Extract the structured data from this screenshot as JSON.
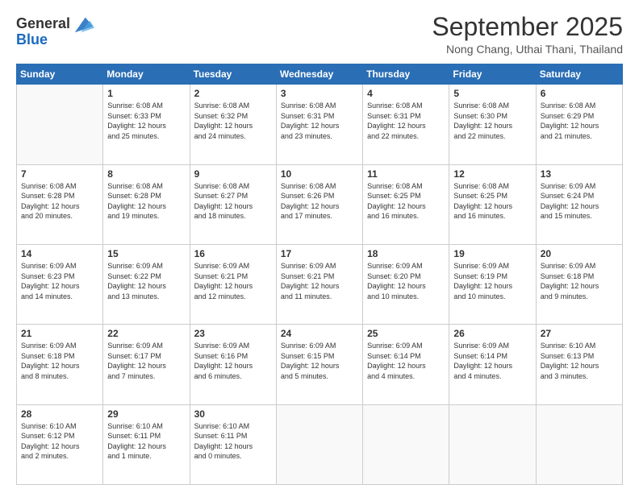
{
  "header": {
    "logo_general": "General",
    "logo_blue": "Blue",
    "month_title": "September 2025",
    "location": "Nong Chang, Uthai Thani, Thailand"
  },
  "days_of_week": [
    "Sunday",
    "Monday",
    "Tuesday",
    "Wednesday",
    "Thursday",
    "Friday",
    "Saturday"
  ],
  "weeks": [
    [
      {
        "day": "",
        "info": ""
      },
      {
        "day": "1",
        "info": "Sunrise: 6:08 AM\nSunset: 6:33 PM\nDaylight: 12 hours\nand 25 minutes."
      },
      {
        "day": "2",
        "info": "Sunrise: 6:08 AM\nSunset: 6:32 PM\nDaylight: 12 hours\nand 24 minutes."
      },
      {
        "day": "3",
        "info": "Sunrise: 6:08 AM\nSunset: 6:31 PM\nDaylight: 12 hours\nand 23 minutes."
      },
      {
        "day": "4",
        "info": "Sunrise: 6:08 AM\nSunset: 6:31 PM\nDaylight: 12 hours\nand 22 minutes."
      },
      {
        "day": "5",
        "info": "Sunrise: 6:08 AM\nSunset: 6:30 PM\nDaylight: 12 hours\nand 22 minutes."
      },
      {
        "day": "6",
        "info": "Sunrise: 6:08 AM\nSunset: 6:29 PM\nDaylight: 12 hours\nand 21 minutes."
      }
    ],
    [
      {
        "day": "7",
        "info": "Sunrise: 6:08 AM\nSunset: 6:28 PM\nDaylight: 12 hours\nand 20 minutes."
      },
      {
        "day": "8",
        "info": "Sunrise: 6:08 AM\nSunset: 6:28 PM\nDaylight: 12 hours\nand 19 minutes."
      },
      {
        "day": "9",
        "info": "Sunrise: 6:08 AM\nSunset: 6:27 PM\nDaylight: 12 hours\nand 18 minutes."
      },
      {
        "day": "10",
        "info": "Sunrise: 6:08 AM\nSunset: 6:26 PM\nDaylight: 12 hours\nand 17 minutes."
      },
      {
        "day": "11",
        "info": "Sunrise: 6:08 AM\nSunset: 6:25 PM\nDaylight: 12 hours\nand 16 minutes."
      },
      {
        "day": "12",
        "info": "Sunrise: 6:08 AM\nSunset: 6:25 PM\nDaylight: 12 hours\nand 16 minutes."
      },
      {
        "day": "13",
        "info": "Sunrise: 6:09 AM\nSunset: 6:24 PM\nDaylight: 12 hours\nand 15 minutes."
      }
    ],
    [
      {
        "day": "14",
        "info": "Sunrise: 6:09 AM\nSunset: 6:23 PM\nDaylight: 12 hours\nand 14 minutes."
      },
      {
        "day": "15",
        "info": "Sunrise: 6:09 AM\nSunset: 6:22 PM\nDaylight: 12 hours\nand 13 minutes."
      },
      {
        "day": "16",
        "info": "Sunrise: 6:09 AM\nSunset: 6:21 PM\nDaylight: 12 hours\nand 12 minutes."
      },
      {
        "day": "17",
        "info": "Sunrise: 6:09 AM\nSunset: 6:21 PM\nDaylight: 12 hours\nand 11 minutes."
      },
      {
        "day": "18",
        "info": "Sunrise: 6:09 AM\nSunset: 6:20 PM\nDaylight: 12 hours\nand 10 minutes."
      },
      {
        "day": "19",
        "info": "Sunrise: 6:09 AM\nSunset: 6:19 PM\nDaylight: 12 hours\nand 10 minutes."
      },
      {
        "day": "20",
        "info": "Sunrise: 6:09 AM\nSunset: 6:18 PM\nDaylight: 12 hours\nand 9 minutes."
      }
    ],
    [
      {
        "day": "21",
        "info": "Sunrise: 6:09 AM\nSunset: 6:18 PM\nDaylight: 12 hours\nand 8 minutes."
      },
      {
        "day": "22",
        "info": "Sunrise: 6:09 AM\nSunset: 6:17 PM\nDaylight: 12 hours\nand 7 minutes."
      },
      {
        "day": "23",
        "info": "Sunrise: 6:09 AM\nSunset: 6:16 PM\nDaylight: 12 hours\nand 6 minutes."
      },
      {
        "day": "24",
        "info": "Sunrise: 6:09 AM\nSunset: 6:15 PM\nDaylight: 12 hours\nand 5 minutes."
      },
      {
        "day": "25",
        "info": "Sunrise: 6:09 AM\nSunset: 6:14 PM\nDaylight: 12 hours\nand 4 minutes."
      },
      {
        "day": "26",
        "info": "Sunrise: 6:09 AM\nSunset: 6:14 PM\nDaylight: 12 hours\nand 4 minutes."
      },
      {
        "day": "27",
        "info": "Sunrise: 6:10 AM\nSunset: 6:13 PM\nDaylight: 12 hours\nand 3 minutes."
      }
    ],
    [
      {
        "day": "28",
        "info": "Sunrise: 6:10 AM\nSunset: 6:12 PM\nDaylight: 12 hours\nand 2 minutes."
      },
      {
        "day": "29",
        "info": "Sunrise: 6:10 AM\nSunset: 6:11 PM\nDaylight: 12 hours\nand 1 minute."
      },
      {
        "day": "30",
        "info": "Sunrise: 6:10 AM\nSunset: 6:11 PM\nDaylight: 12 hours\nand 0 minutes."
      },
      {
        "day": "",
        "info": ""
      },
      {
        "day": "",
        "info": ""
      },
      {
        "day": "",
        "info": ""
      },
      {
        "day": "",
        "info": ""
      }
    ]
  ]
}
